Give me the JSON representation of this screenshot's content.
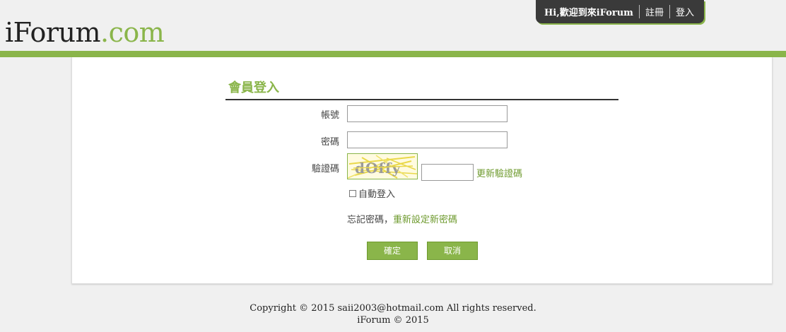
{
  "header": {
    "logo_main": "iForum",
    "logo_suffix": ".com",
    "welcome": "Hi,歡迎到來iForum",
    "register_label": "註冊",
    "login_label": "登入"
  },
  "login": {
    "title": "會員登入",
    "account_label": "帳號",
    "account_value": "",
    "password_label": "密碼",
    "password_value": "",
    "captcha_label": "驗證碼",
    "captcha_text": "dOffy",
    "captcha_value": "",
    "refresh_captcha": "更新驗證碼",
    "remember_label": "自動登入",
    "remember_checked": false,
    "forgot_text": "忘記密碼，",
    "reset_link": "重新設定新密碼",
    "confirm_button": "確定",
    "cancel_button": "取消"
  },
  "footer": {
    "copyright": "Copyright © 2015 saii2003@hotmail.com All rights reserved.",
    "brand": "iForum © 2015"
  },
  "colors": {
    "accent_green": "#8ab54a",
    "dark_nav": "#3a3a3a"
  }
}
